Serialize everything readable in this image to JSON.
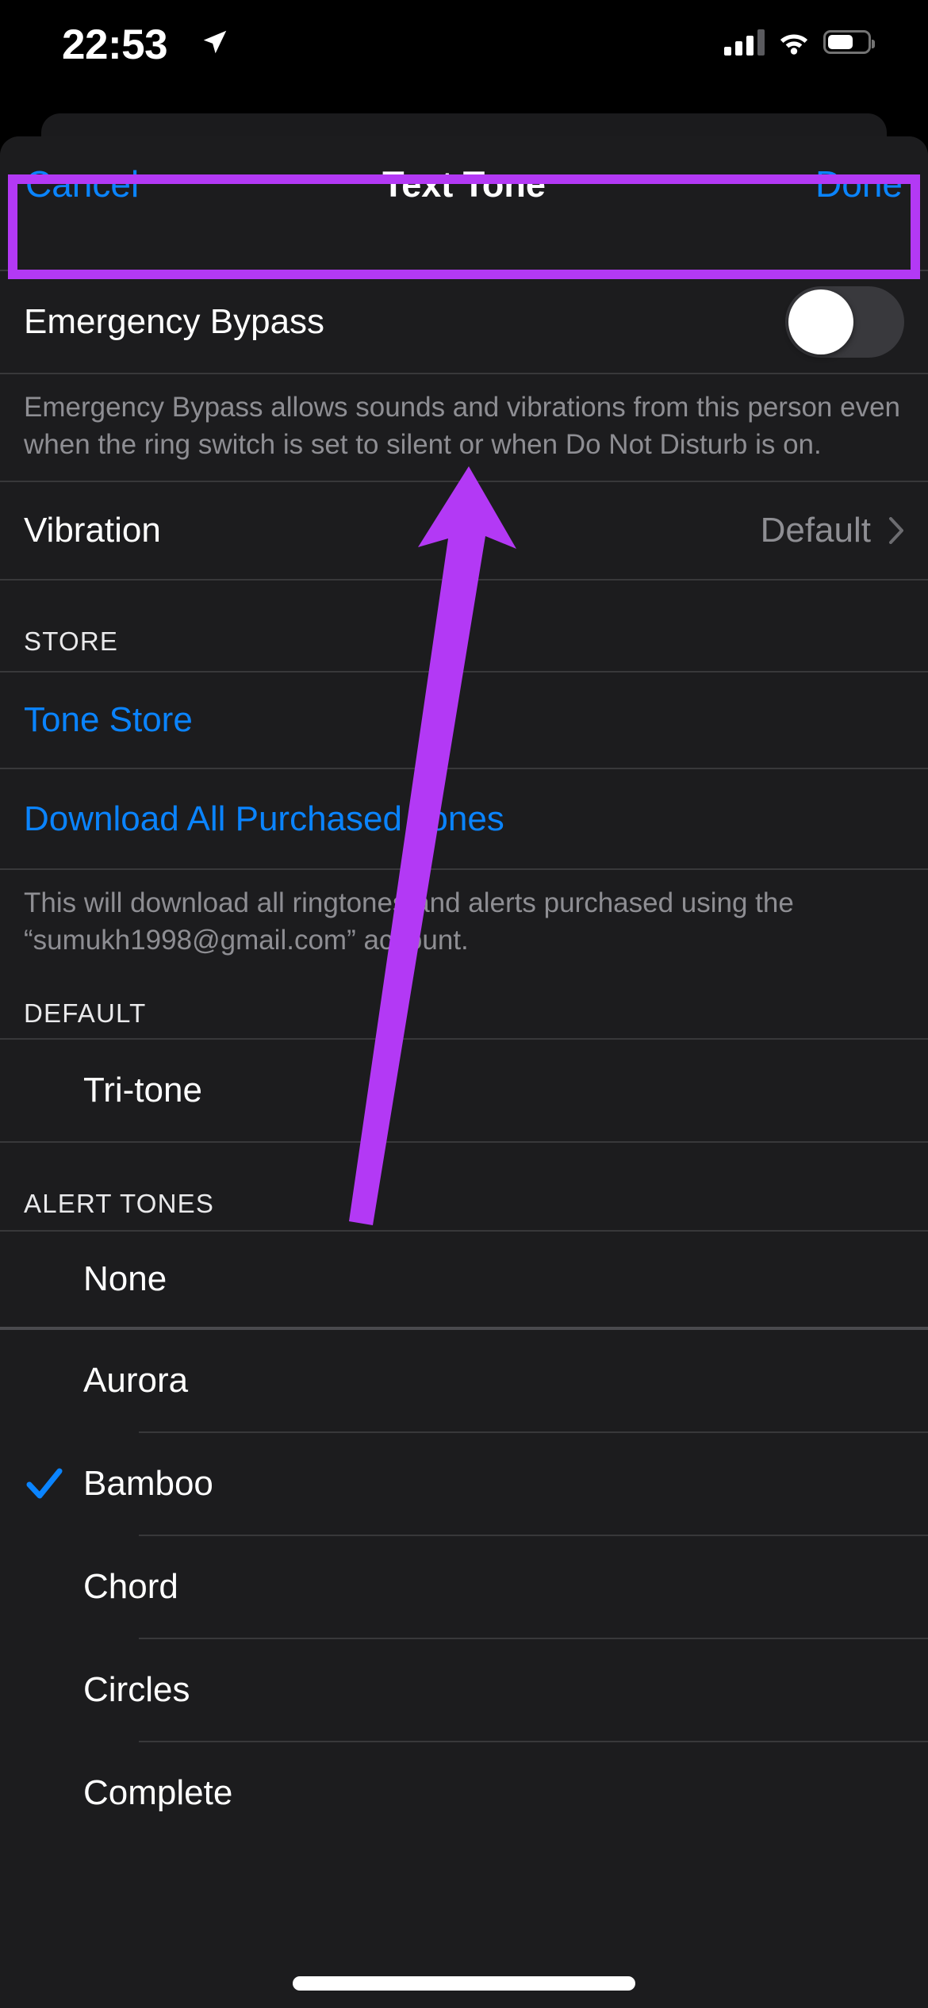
{
  "status_bar": {
    "time": "22:53",
    "location_icon": "location-arrow-icon",
    "cellular_icon": "cellular-signal-icon",
    "wifi_icon": "wifi-icon",
    "battery_icon": "battery-icon"
  },
  "nav": {
    "cancel_label": "Cancel",
    "title": "Text Tone",
    "done_label": "Done"
  },
  "emergency_bypass": {
    "label": "Emergency Bypass",
    "toggle_state": "off",
    "footnote": "Emergency Bypass allows sounds and vibrations from this person even when the ring switch is set to silent or when Do Not Disturb is on."
  },
  "vibration": {
    "label": "Vibration",
    "value": "Default",
    "chevron_icon": "chevron-right-icon"
  },
  "store": {
    "header": "STORE",
    "tone_store_label": "Tone Store",
    "download_all_label": "Download All Purchased Tones",
    "footnote": "This will download all ringtones and alerts purchased using the “sumukh1998@gmail.com” account."
  },
  "default_section": {
    "header": "DEFAULT",
    "items": [
      {
        "name": "Tri-tone",
        "selected": false
      }
    ]
  },
  "alert_tones_section": {
    "header": "ALERT TONES",
    "items": [
      {
        "name": "None",
        "selected": false
      },
      {
        "name": "Aurora",
        "selected": false
      },
      {
        "name": "Bamboo",
        "selected": true
      },
      {
        "name": "Chord",
        "selected": false
      },
      {
        "name": "Circles",
        "selected": false
      },
      {
        "name": "Complete",
        "selected": false
      }
    ]
  },
  "annotation": {
    "highlight_color": "#b339f5",
    "arrow_color": "#b339f5",
    "highlight_target": "Emergency Bypass",
    "arrow_target": "emergency-bypass-toggle"
  },
  "colors": {
    "background": "#000000",
    "sheet": "#1c1c1e",
    "accent_blue": "#0a84ff",
    "secondary_text": "#8e8e93",
    "separator": "#38383a",
    "toggle_track_off": "#39393d"
  }
}
